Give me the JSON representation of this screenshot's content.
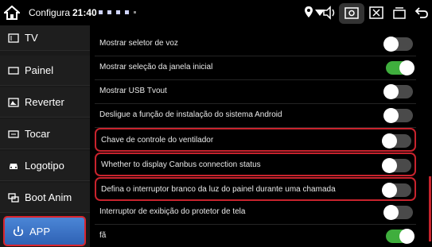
{
  "statusbar": {
    "title": "Configura",
    "time": "21:40"
  },
  "sidebar": {
    "items": [
      {
        "label": "TV",
        "icon": "tv-icon"
      },
      {
        "label": "Painel",
        "icon": "panel-icon"
      },
      {
        "label": "Reverter",
        "icon": "reverse-camera-icon"
      },
      {
        "label": "Tocar",
        "icon": "touch-icon"
      },
      {
        "label": "Logotipo",
        "icon": "car-logo-icon"
      },
      {
        "label": "Boot Anim",
        "icon": "boot-animation-icon"
      },
      {
        "label": "APP",
        "icon": "app-icon"
      }
    ],
    "active_index": 6
  },
  "settings": [
    {
      "label": "Mostrar seletor de voz",
      "on": false
    },
    {
      "label": "Mostrar seleção da janela inicial",
      "on": true
    },
    {
      "label": "Mostrar USB Tvout",
      "on": false
    },
    {
      "label": "Desligue a função de instalação do sistema Android",
      "on": false
    },
    {
      "label": "Chave de controle do ventilador",
      "on": false
    },
    {
      "label": "Whether to display Canbus connection status",
      "on": false
    },
    {
      "label": "Defina o interruptor branco da luz do painel durante uma chamada",
      "on": false
    },
    {
      "label": "Interruptor de exibição do protetor de tela",
      "on": false
    },
    {
      "label": "fã",
      "on": true
    }
  ],
  "colors": {
    "accent_blue": "#3b74c9",
    "toggle_on": "#3fae3d",
    "highlight_red": "#c8232d"
  }
}
